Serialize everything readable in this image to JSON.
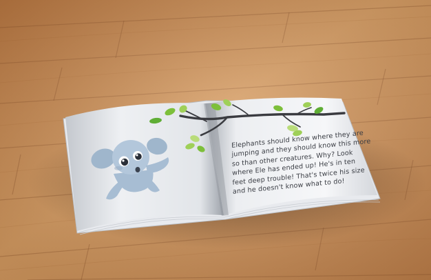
{
  "scene": {
    "colors": {
      "floor_light": "#d69a60",
      "floor_dark": "#b06d38",
      "page_light": "#f4f5f7",
      "page_shadow": "#aeb2b8",
      "elephant": "#a7bdd3",
      "branch": "#3a3b40",
      "leaf_green": "#7dbf3a",
      "leaf_light": "#b9dc7a"
    },
    "icons": {
      "elephant": "elephant-illustration",
      "branch": "tree-branch-illustration"
    }
  },
  "book": {
    "story_lines": [
      "Elephants should know where they are",
      "jumping and they should know this more",
      "so than other creatures. Why? Look",
      "where Ele has ended up! He's in ten",
      "feet deep trouble! That's twice his size",
      "and he doesn't know what to do!"
    ]
  }
}
